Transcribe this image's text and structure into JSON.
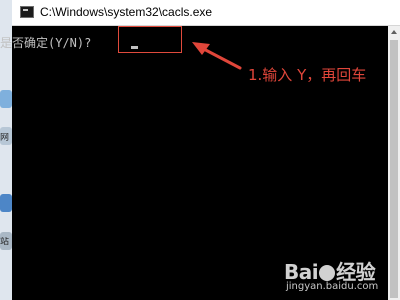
{
  "window": {
    "title": "C:\\Windows\\system32\\cacls.exe",
    "icon": "console-app-icon"
  },
  "console": {
    "prompt": "是否确定(Y/N)?",
    "prompt_prefix_cut": "是否确定(Y/N)?"
  },
  "annotation": {
    "text": "1.输入 Y，再回车",
    "color": "#e0463a"
  },
  "desktop_strip": {
    "label_1": "网",
    "label_2": "站"
  },
  "watermark": {
    "logo_left": "Bai",
    "logo_right": "经验",
    "url": "jingyan.baidu.com"
  },
  "colors": {
    "console_bg": "#000000",
    "console_text": "#c0c0c0",
    "annotation": "#e0463a",
    "titlebar": "#ffffff"
  }
}
